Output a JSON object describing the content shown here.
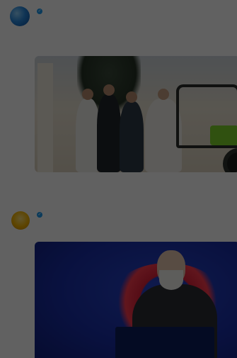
{
  "tweets": [
    {
      "display_name": "",
      "handle": "",
      "lines": [
        "",
        "",
        "",
        ""
      ],
      "quoted_line": "",
      "meta_line": ""
    },
    {
      "retweet_line": "",
      "display_name": "",
      "handle": "",
      "lines": [
        "",
        ""
      ],
      "banner_text": ""
    }
  ],
  "icons": {
    "verified_badge": "verified-badge-icon",
    "avatar_1": "globe-avatar",
    "avatar_2": "emoji-avatar"
  },
  "colors": {
    "accent": "#1d9bf0",
    "overlay": "rgba(0,0,0,0.62)"
  }
}
